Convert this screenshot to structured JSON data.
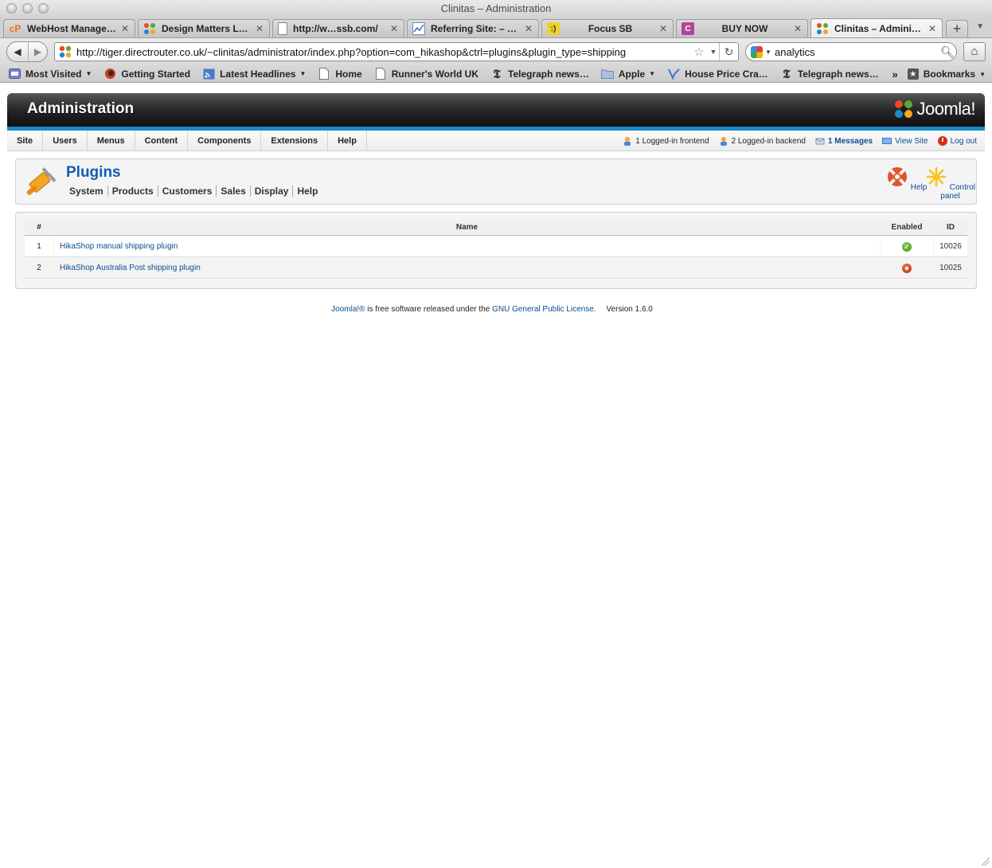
{
  "window": {
    "title": "Clinitas – Administration"
  },
  "tabs": [
    {
      "label": "WebHost Manage…",
      "icon": "cpanel-icon",
      "color": "#f08a24",
      "center": false
    },
    {
      "label": "Design Matters L…",
      "icon": "joomla-favicon",
      "color": "#333333",
      "center": false
    },
    {
      "label": "http://w…ssb.com/",
      "icon": "page-icon",
      "color": "#ffffff",
      "center": false
    },
    {
      "label": "Referring Site: – …",
      "icon": "analytics-icon",
      "color": "#ffffff",
      "center": false
    },
    {
      "label": "Focus SB",
      "icon": "focus-icon",
      "color": "#f0cf2a",
      "center": true
    },
    {
      "label": "BUY NOW",
      "icon": "c-icon",
      "color": "#b0449c",
      "center": true
    },
    {
      "label": "Clinitas – Admini…",
      "icon": "joomla-favicon",
      "color": "#ffffff",
      "center": false,
      "active": true
    }
  ],
  "nav": {
    "url": "http://tiger.directrouter.co.uk/~clinitas/administrator/index.php?option=com_hikashop&ctrl=plugins&plugin_type=shipping",
    "search": "analytics"
  },
  "bookmarks": [
    {
      "label": "Most Visited",
      "icon": "most-visited-icon",
      "dropdown": true
    },
    {
      "label": "Getting Started",
      "icon": "firefox-icon",
      "dropdown": false
    },
    {
      "label": "Latest Headlines",
      "icon": "rss-icon",
      "dropdown": true
    },
    {
      "label": "Home",
      "icon": "page-icon",
      "dropdown": false
    },
    {
      "label": "Runner's World UK",
      "icon": "page-icon",
      "dropdown": false
    },
    {
      "label": "Telegraph news…",
      "icon": "telegraph-icon",
      "dropdown": false
    },
    {
      "label": "Apple",
      "icon": "folder-icon",
      "dropdown": true
    },
    {
      "label": "House Price Cra…",
      "icon": "bookmark-icon",
      "dropdown": false
    },
    {
      "label": "Telegraph news…",
      "icon": "telegraph-icon",
      "dropdown": false
    }
  ],
  "bookmarks_menu": "Bookmarks",
  "admin": {
    "header_title": "Administration",
    "logo_text": "Joomla!",
    "menu": [
      "Site",
      "Users",
      "Menus",
      "Content",
      "Components",
      "Extensions",
      "Help"
    ],
    "status": {
      "frontend": "1 Logged-in frontend",
      "backend": "2 Logged-in backend",
      "messages": "1 Messages",
      "view_site": "View Site",
      "logout": "Log out"
    }
  },
  "page": {
    "title": "Plugins",
    "subnav": [
      "System",
      "Products",
      "Customers",
      "Sales",
      "Display",
      "Help"
    ],
    "toolbar": {
      "help": "Help",
      "control_panel": "Control panel"
    }
  },
  "table": {
    "headers": {
      "num": "#",
      "name": "Name",
      "enabled": "Enabled",
      "id": "ID"
    },
    "rows": [
      {
        "num": "1",
        "name": "HikaShop manual shipping plugin",
        "enabled": true,
        "id": "10026"
      },
      {
        "num": "2",
        "name": "HikaShop Australia Post shipping plugin",
        "enabled": false,
        "id": "10025"
      }
    ]
  },
  "footer": {
    "joomla_link": "Joomla!®",
    "text": " is free software released under the ",
    "license_link": "GNU General Public License.",
    "version": "Version 1.6.0"
  },
  "colors": {
    "accent": "#1c8ac7",
    "link": "#0b4d8c",
    "title": "#135cae"
  }
}
